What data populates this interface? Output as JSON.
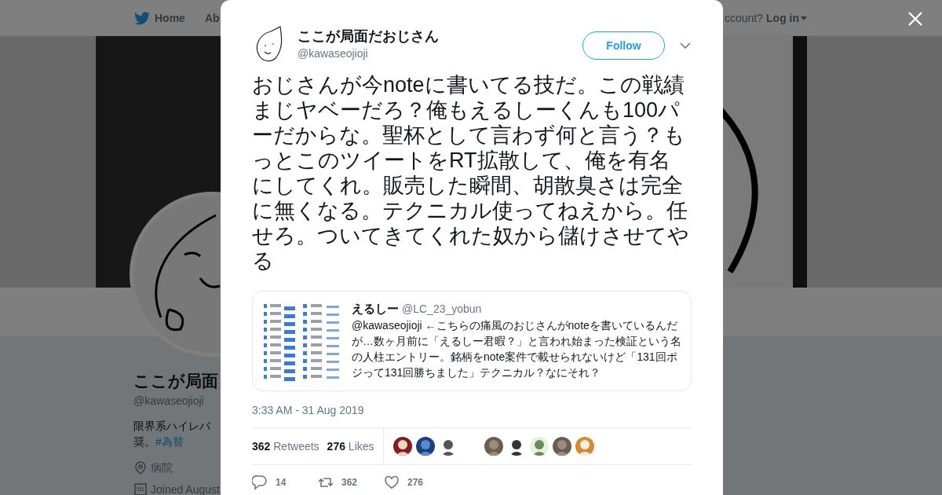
{
  "nav": {
    "items": [
      "Home",
      "Ab"
    ],
    "login_prompt": "ccount?",
    "login_link": "Log in"
  },
  "profile": {
    "name": "ここが局面",
    "handle": "@kawaseojioji",
    "bio_line1": "限界系ハイレバ",
    "bio_line2": "奨。",
    "hashtag": "#為替",
    "location": "病院",
    "joined": "Joined August"
  },
  "tweet": {
    "name": "ここが局面だおじさん",
    "handle": "@kawaseojioji",
    "follow": "Follow",
    "text": "おじさんが今noteに書いてる技だ。この戦績まじヤベーだろ？俺もえるしーくんも100パーだからな。聖杯として言わず何と言う？もっとこのツイートをRT拡散して、俺を有名にしてくれ。販売した瞬間、胡散臭さは完全に無くなる。テクニカル使ってねえから。任せろ。ついてきてくれた奴から儲けさせてやる",
    "quote": {
      "name": "えるしー",
      "handle": "@LC_23_yobun",
      "text": "@kawaseojioji ←こちらの痛風のおじさんがnoteを書いているんだが…数ヶ月前に「えるしー君暇？」と言われ始まった検証という名の人柱エントリー。銘柄をnote案件で載せられないけど「131回ポジって131回勝ちました」テクニカル？なにそれ？"
    },
    "timestamp": "3:33 AM - 31 Aug 2019",
    "stats": [
      {
        "count": "362",
        "label": "Retweets"
      },
      {
        "count": "276",
        "label": "Likes"
      }
    ],
    "actions": [
      {
        "kind": "reply",
        "count": "14"
      },
      {
        "kind": "retweet",
        "count": "362"
      },
      {
        "kind": "like",
        "count": "276"
      }
    ]
  }
}
